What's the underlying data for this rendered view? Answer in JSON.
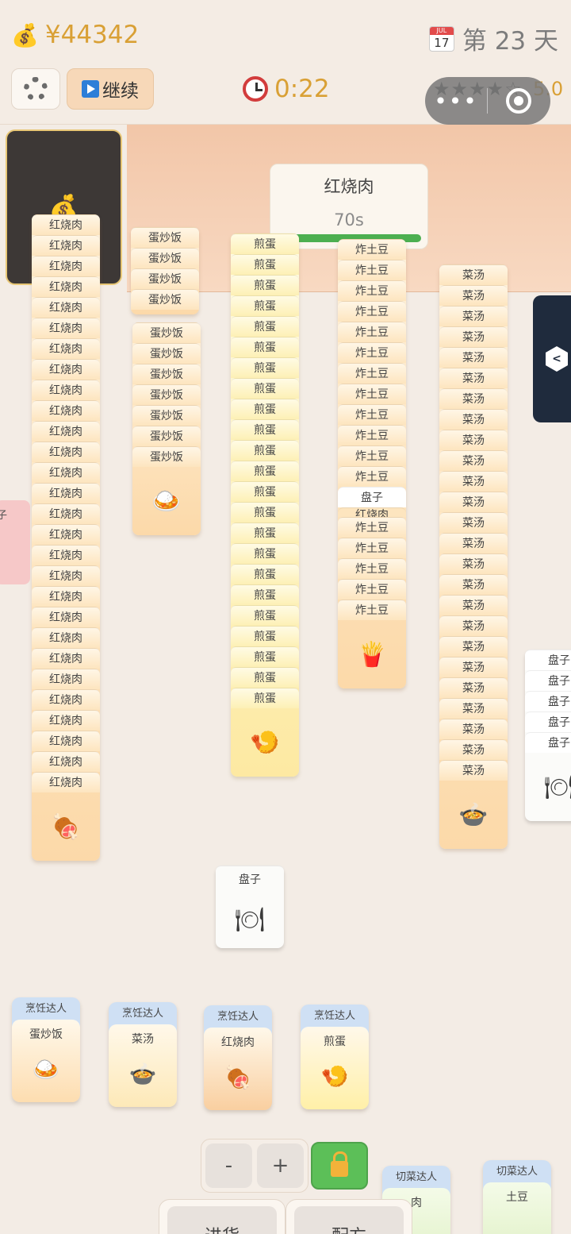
{
  "header": {
    "money_icon": "money-bag",
    "money": "¥44342",
    "calendar_icon": "calendar",
    "calendar_month": "JUL",
    "calendar_day": "17",
    "day_label": "第 23 天",
    "continue_label": "继续",
    "timer": "0:22",
    "stars": "★★★★☆",
    "rating": "5.0"
  },
  "order": {
    "name": "红烧肉",
    "time": "70s",
    "progress": 1.0
  },
  "stacks": {
    "hongshaorou": {
      "label": "红烧肉",
      "icon": "🍖"
    },
    "danchaofan": {
      "label": "蛋炒饭",
      "icon": "🍛"
    },
    "jiandan": {
      "label": "煎蛋",
      "icon": "🍤"
    },
    "zhatudou": {
      "label": "炸土豆",
      "icon": "🍟",
      "plate_label": "盘子",
      "partial_label": "红烧肉"
    },
    "caitang": {
      "label": "菜汤",
      "icon": "🍲"
    },
    "plates_right": {
      "label": "盘子",
      "icon": "🍽"
    },
    "plate_single": {
      "label": "盘子",
      "icon": "🍽"
    },
    "pink_partial": {
      "label": "子"
    }
  },
  "workers": [
    {
      "role": "烹饪达人",
      "dish": "蛋炒饭",
      "icon": "🍛"
    },
    {
      "role": "烹饪达人",
      "dish": "菜汤",
      "icon": "🍲"
    },
    {
      "role": "烹饪达人",
      "dish": "红烧肉",
      "icon": "🍖"
    },
    {
      "role": "烹饪达人",
      "dish": "煎蛋",
      "icon": "🍤"
    }
  ],
  "cutters": [
    {
      "role": "切菜达人",
      "dish": "肉"
    },
    {
      "role": "切菜达人",
      "dish": "土豆"
    }
  ],
  "controls": {
    "minus": "-",
    "plus": "+"
  },
  "bottom_tabs": {
    "stock": "进货",
    "recipe": "配方"
  }
}
